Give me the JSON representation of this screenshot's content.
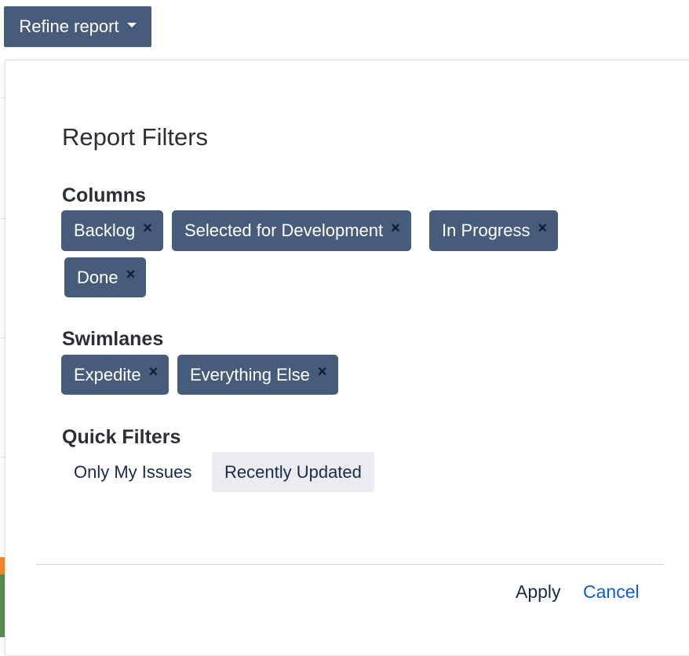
{
  "toolbar": {
    "refine_label": "Refine report",
    "refine_icon": "chevron-down-icon"
  },
  "panel": {
    "title": "Report Filters",
    "columns": {
      "title": "Columns",
      "chips": [
        {
          "label": "Backlog",
          "remove": "×"
        },
        {
          "label": "Selected for Development",
          "remove": "×"
        },
        {
          "label": "In Progress",
          "remove": "×"
        },
        {
          "label": "Done",
          "remove": "×"
        }
      ]
    },
    "swimlanes": {
      "title": "Swimlanes",
      "chips": [
        {
          "label": "Expedite",
          "remove": "×"
        },
        {
          "label": "Everything Else",
          "remove": "×"
        }
      ]
    },
    "quick_filters": {
      "title": "Quick Filters",
      "items": [
        {
          "label": "Only My Issues",
          "selected": false
        },
        {
          "label": "Recently Updated",
          "selected": true
        }
      ]
    },
    "footer": {
      "apply_label": "Apply",
      "cancel_label": "Cancel"
    }
  },
  "colors": {
    "chip_bg": "#475c7a",
    "chip_text": "#ffffff",
    "link_blue": "#0b5fd0",
    "selected_filter_bg": "#ebecf0"
  }
}
